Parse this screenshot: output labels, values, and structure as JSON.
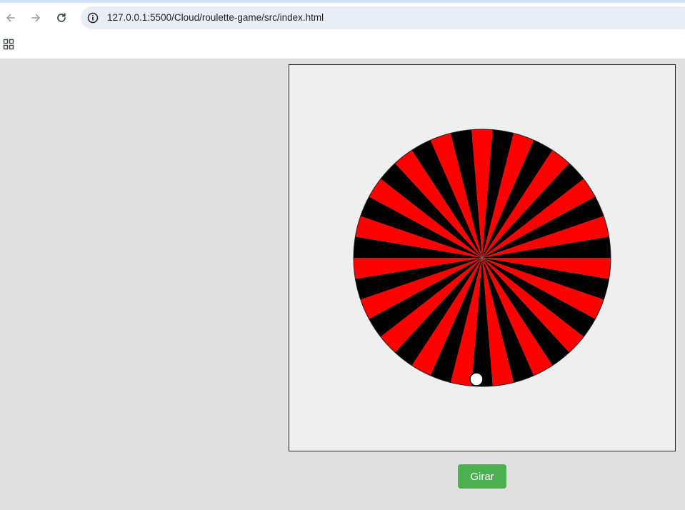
{
  "browser": {
    "url": "127.0.0.1:5500/Cloud/roulette-game/src/index.html",
    "icons": {
      "back": "back-arrow-icon",
      "forward": "forward-arrow-icon",
      "reload": "reload-icon",
      "site_info": "info-icon",
      "apps": "apps-grid-icon"
    }
  },
  "game": {
    "spin_label": "Girar",
    "wheel": {
      "segment_count": 38,
      "segment_colors": [
        "#ff0000",
        "#000000"
      ],
      "ball_color": "#ffffff"
    },
    "colors": {
      "canvas_background": "#efefef",
      "page_background": "#e0e0e0",
      "button_background": "#4caf50"
    }
  }
}
